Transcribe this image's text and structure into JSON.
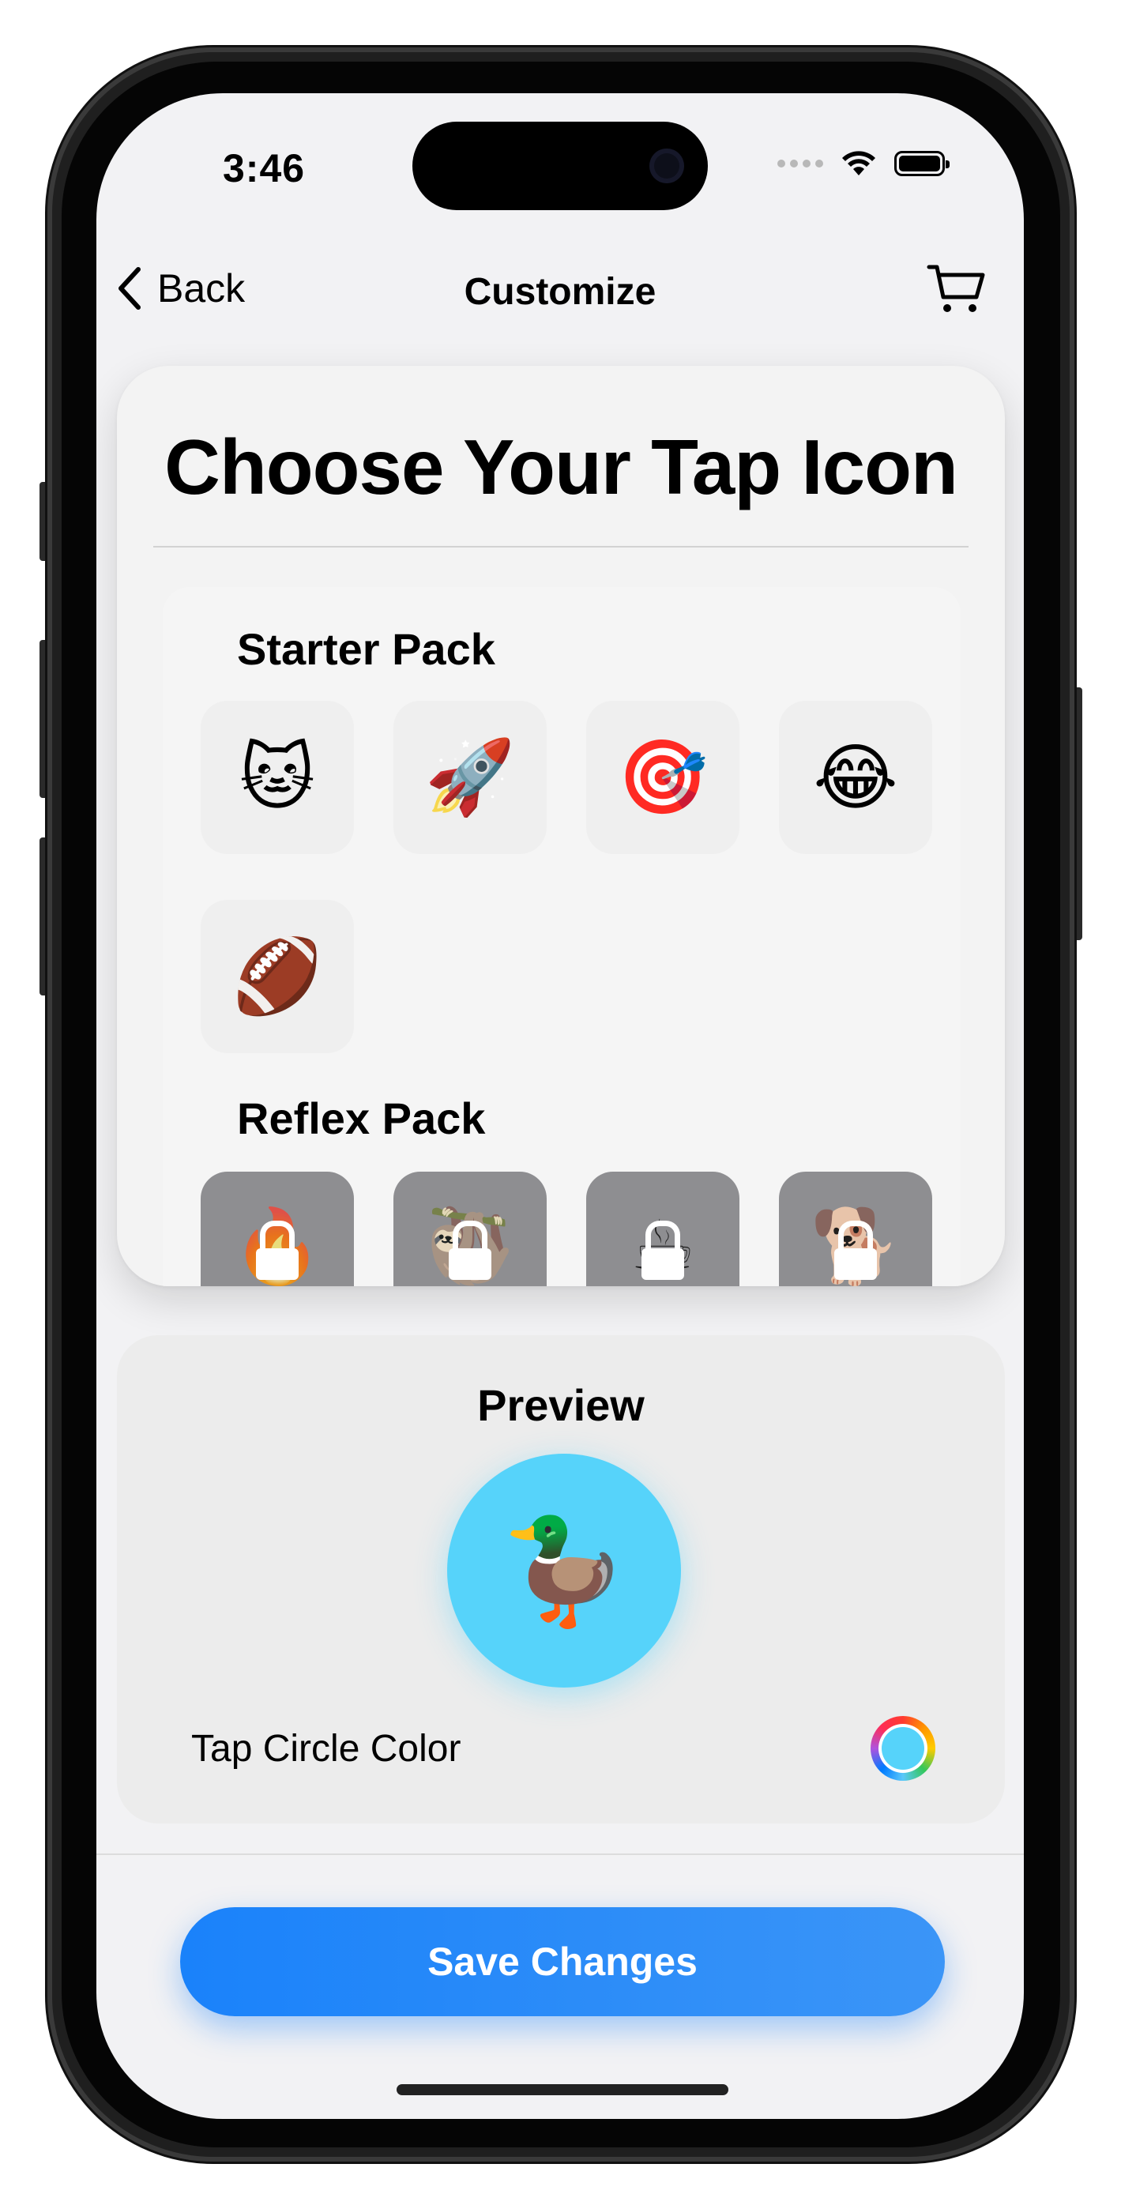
{
  "status_bar": {
    "time": "3:46"
  },
  "nav": {
    "back_label": "Back",
    "title": "Customize"
  },
  "picker": {
    "title": "Choose Your Tap Icon",
    "packs": [
      {
        "name": "Starter Pack",
        "icons": [
          "🐱",
          "🚀",
          "🎯",
          "😂",
          "🏈"
        ]
      },
      {
        "name": "Reflex Pack",
        "icons": [
          "🔥",
          "🦥",
          "☕",
          "🐕"
        ],
        "locked": true
      }
    ]
  },
  "preview": {
    "title": "Preview",
    "icon": "🦆",
    "circle_color": "#56d3fa",
    "color_label": "Tap Circle Color"
  },
  "save_button": {
    "label": "Save Changes",
    "color": "#1a82fa"
  }
}
